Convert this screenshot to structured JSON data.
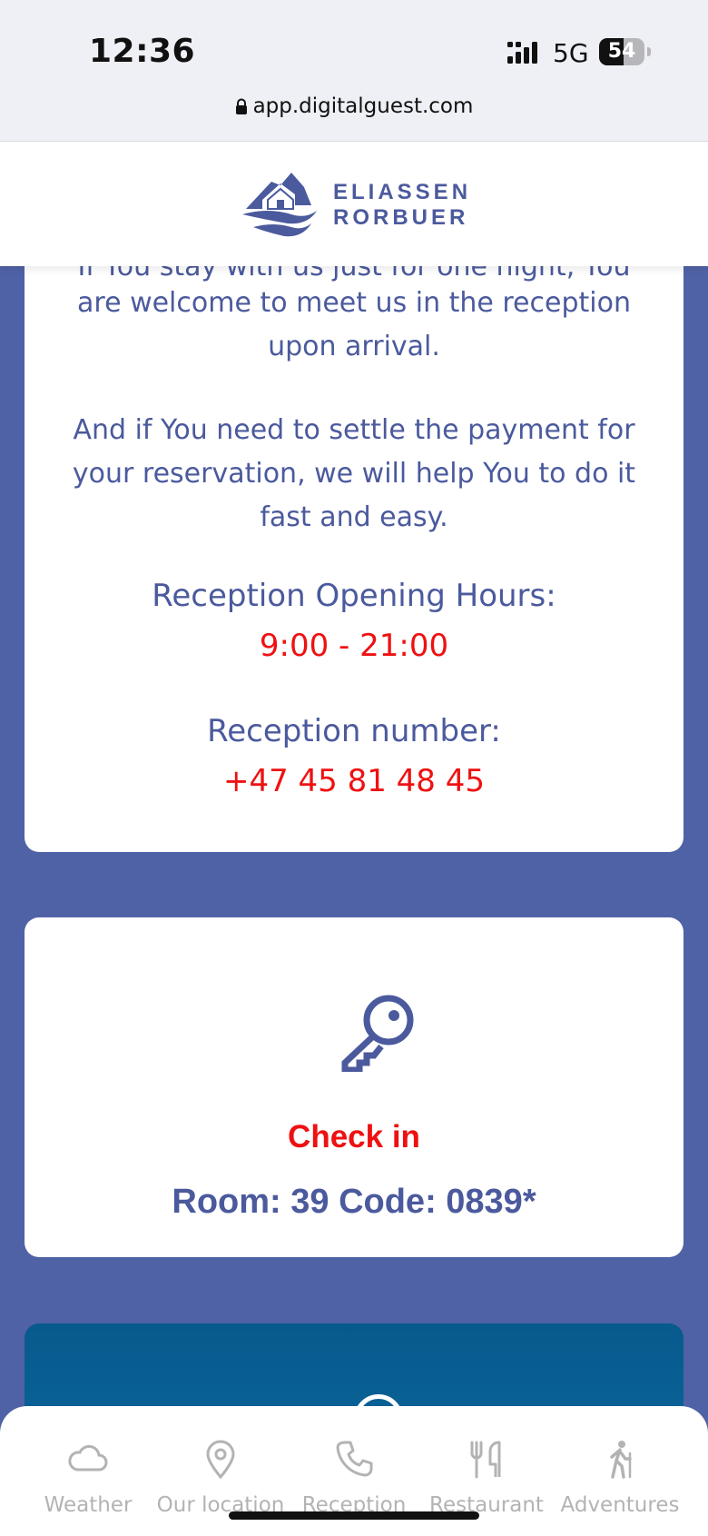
{
  "status_bar": {
    "time": "12:36",
    "network": "5G",
    "battery_percent": 54,
    "battery_label": "54"
  },
  "browser": {
    "url": "app.digitalguest.com"
  },
  "header": {
    "brand_line1": "ELIASSEN",
    "brand_line2": "RORBUER"
  },
  "reception_card": {
    "cut_line": "If You stay with us just for one night, You",
    "paragraph1": "are welcome to meet us in the reception upon arrival.",
    "paragraph2": "And if You need to settle the payment for your reservation, we will help You to do it fast and easy.",
    "hours_label": "Reception Opening Hours:",
    "hours_value": "9:00 - 21:00",
    "phone_label": "Reception number:",
    "phone_value": "+47 45 81 48 45"
  },
  "checkin_card": {
    "icon": "key-icon",
    "title": "Check in",
    "room_code": "Room: 39 Code: 0839*"
  },
  "tabs": [
    {
      "label": "Weather",
      "icon": "cloud-icon"
    },
    {
      "label": "Our location",
      "icon": "map-pin-icon"
    },
    {
      "label": "Reception",
      "icon": "phone-icon"
    },
    {
      "label": "Restaurant",
      "icon": "utensils-icon"
    },
    {
      "label": "Adventures",
      "icon": "hiker-icon"
    }
  ],
  "colors": {
    "background": "#5062a6",
    "brand_blue": "#4b5a9d",
    "accent_red": "#ee1111",
    "tab_gray": "#b3b3b3"
  }
}
